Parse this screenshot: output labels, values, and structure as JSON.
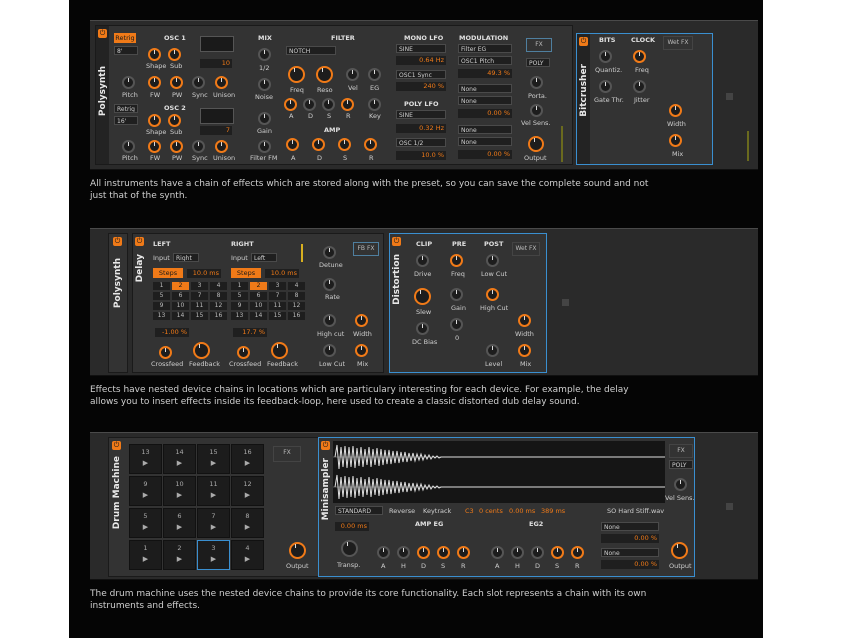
{
  "panel1": {
    "title": "Polysynth",
    "osc1": {
      "title": "OSC 1",
      "retrig": "Retrig",
      "octave": "8'",
      "shape": "Shape",
      "sub": "Sub",
      "pitch": "Pitch",
      "fw": "FW",
      "pw": "PW",
      "sync": "Sync",
      "unison": "Unison",
      "voices": "10"
    },
    "osc2": {
      "title": "OSC 2",
      "retrig": "Retrig",
      "octave": "16'",
      "shape": "Shape",
      "sub": "Sub",
      "pitch": "Pitch",
      "fw": "FW",
      "pw": "PW",
      "sync": "Sync",
      "unison": "Unison",
      "voices": "7"
    },
    "mix": {
      "title": "MIX",
      "ratio": "1/2",
      "noise": "Noise",
      "gain": "Gain",
      "filter_fm": "Filter FM"
    },
    "filter": {
      "title": "FILTER",
      "type": "NOTCH",
      "freq": "Freq",
      "reso": "Reso",
      "vel": "Vel",
      "eg": "EG",
      "a": "A",
      "d": "D",
      "s": "S",
      "r": "R",
      "key": "Key"
    },
    "amp": {
      "title": "AMP",
      "a": "A",
      "d": "D",
      "s": "S",
      "r": "R"
    },
    "mono_lfo": {
      "title": "MONO LFO",
      "wave": "SINE",
      "rate": "0.64 Hz",
      "target": "OSC1 Sync",
      "amount": "240 %"
    },
    "poly_lfo": {
      "title": "POLY LFO",
      "wave": "SINE",
      "rate": "0.32 Hz",
      "target": "OSC 1/2",
      "amount": "10.0 %"
    },
    "modulation": {
      "title": "MODULATION",
      "src1": "Filter EG",
      "dst1": "OSC1 Pitch",
      "amt1": "49.3 %",
      "src2": "None",
      "dst2": "None",
      "amt2": "0.00 %",
      "src3": "None",
      "dst3": "None",
      "amt3": "0.00 %"
    },
    "misc": {
      "fx": "FX",
      "poly": "POLY",
      "porta": "Porta.",
      "vel_sens": "Vel Sens.",
      "output": "Output"
    },
    "bitcrusher": {
      "title": "Bitcrusher",
      "bits": "BITS",
      "clock": "CLOCK",
      "quantiz": "Quantiz.",
      "freq": "Freq",
      "gate_thr": "Gate Thr.",
      "jitter": "Jitter",
      "wet_fx": "Wet FX",
      "width": "Width",
      "mix": "Mix"
    }
  },
  "caption1": "All instruments have a chain of effects which are stored along with the preset, so you can save the complete sound and not just that of the synth.",
  "panel2": {
    "title": "Polysynth",
    "delay": {
      "title": "Delay",
      "left": "LEFT",
      "right": "RIGHT",
      "input": "Input",
      "left_input": "Right",
      "right_input": "Left",
      "steps": "Steps",
      "left_time": "10.0 ms",
      "right_time": "10.0 ms",
      "left_pct": "-1.00 %",
      "right_pct": "17.7 %",
      "crossfeed": "Crossfeed",
      "feedback": "Feedback",
      "detune": "Detune",
      "rate": "Rate",
      "high_cut": "High cut",
      "low_cut": "Low Cut",
      "width": "Width",
      "mix": "Mix",
      "fb_fx": "FB FX"
    },
    "grid": [
      "1",
      "2",
      "3",
      "4",
      "5",
      "6",
      "7",
      "8",
      "9",
      "10",
      "11",
      "12",
      "13",
      "14",
      "15",
      "16"
    ],
    "distortion": {
      "title": "Distortion",
      "clip": "CLIP",
      "pre": "PRE",
      "post": "POST",
      "drive": "Drive",
      "freq": "Freq",
      "low_cut": "Low Cut",
      "slew": "Slew",
      "gain": "Gain",
      "high_cut": "High Cut",
      "dc_bias": "DC Bias",
      "zero": "0",
      "level": "Level",
      "width": "Width",
      "mix": "Mix",
      "wet_fx": "Wet FX"
    }
  },
  "caption2": "Effects have nested device chains in locations which are particulary interesting for each device. For example, the delay allows you to insert effects inside its feedback-loop, here used to create a classic distorted dub delay sound.",
  "panel3": {
    "title": "Drum Machine",
    "pads": [
      "13",
      "14",
      "15",
      "16",
      "9",
      "10",
      "11",
      "12",
      "5",
      "6",
      "7",
      "8",
      "1",
      "2",
      "3",
      "4"
    ],
    "fx": "FX",
    "output": "Output",
    "sampler": {
      "title": "Minisampler",
      "mode": "STANDARD",
      "reverse": "Reverse",
      "keytrack": "Keytrack",
      "note": "C3",
      "cents": "0 cents",
      "start": "0.00 ms",
      "length": "389 ms",
      "file": "SO Hard Stiff.wav",
      "amp_eg": "AMP EG",
      "eg2": "EG2",
      "time": "0.00 ms",
      "transp": "Transp.",
      "a": "A",
      "h": "H",
      "d": "D",
      "s": "S",
      "r": "R",
      "mod1_src": "None",
      "mod1_amt": "0.00 %",
      "mod2_src": "None",
      "mod2_amt": "0.00 %",
      "fx": "FX",
      "poly": "POLY",
      "vel_sens": "Vel Sens.",
      "output": "Output"
    }
  },
  "caption3": "The drum machine uses the nested device chains to provide its core functionality. Each slot represents a chain with its own instruments and effects.",
  "colors": {
    "accent": "#f07a18",
    "selection": "#3a8fd0",
    "background": "#050505",
    "panel": "#2a2a2a"
  }
}
